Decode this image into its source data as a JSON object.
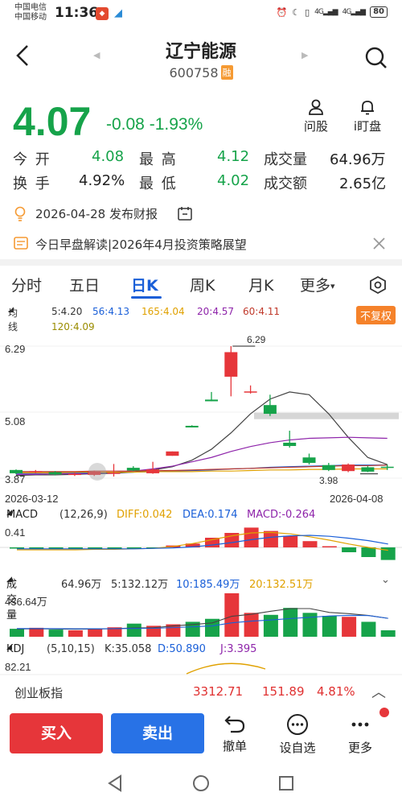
{
  "status_bar": {
    "carrier1": "中国电信",
    "carrier2": "中国移动",
    "time": "11:36",
    "signal1": "4G",
    "signal2": "4G",
    "battery": "80"
  },
  "header": {
    "stock_name": "辽宁能源",
    "stock_code": "600758",
    "badge": "融"
  },
  "quote": {
    "price": "4.07",
    "change": "-0.08",
    "change_pct": "-1.93%",
    "ask_label": "问股",
    "watch_label": "i盯盘",
    "open_label": "今 开",
    "open": "4.08",
    "high_label": "最 高",
    "high": "4.12",
    "volume_label": "成交量",
    "volume": "64.96万",
    "turnover_label": "换 手",
    "turnover": "4.92%",
    "low_label": "最 低",
    "low": "4.02",
    "amount_label": "成交额",
    "amount": "2.65亿"
  },
  "report": {
    "text": "2026-04-28 发布财报"
  },
  "news": {
    "text": "今日早盘解读|2026年4月投资策略展望"
  },
  "tabs": [
    "分时",
    "五日",
    "日K",
    "周K",
    "月K",
    "更多"
  ],
  "ma": {
    "title": "均线",
    "ma5": "5:4.20",
    "ma56": "56:4.13",
    "ma165": "165:4.04",
    "ma20": "20:4.57",
    "ma60": "60:4.11",
    "ma120": "120:4.09",
    "fuquan": "不复权"
  },
  "kline": {
    "y_top": "6.29",
    "y_mid": "5.08",
    "y_bottom": "3.87",
    "high_mark": "6.29",
    "low_mark": "3.98",
    "date_start": "2026-03-12",
    "date_end": "2026-04-08"
  },
  "macd": {
    "title": "MACD",
    "params": "(12,26,9)",
    "diff": "DIFF:0.042",
    "dea": "DEA:0.174",
    "macd": "MACD:-0.264",
    "top": "0.41"
  },
  "volume": {
    "title": "成交量",
    "value": "64.96万",
    "v5": "5:132.12万",
    "v10": "10:185.49万",
    "v20": "20:132.51万",
    "top": "436.64万"
  },
  "kdj": {
    "title": "KDJ",
    "params": "(5,10,15)",
    "k": "K:35.058",
    "d": "D:50.890",
    "j": "J:3.395",
    "top": "82.21"
  },
  "index_bar": {
    "name": "创业板指",
    "value": "3312.71",
    "change": "151.89",
    "pct": "4.81%"
  },
  "actions": {
    "buy": "买入",
    "sell": "卖出",
    "cancel": "撤单",
    "watchlist": "设自选",
    "more": "更多"
  },
  "colors": {
    "up": "#e6363a",
    "down": "#16a34a",
    "accent": "#1a5fd8"
  },
  "chart_data": [
    {
      "type": "candlestick",
      "title": "",
      "ylim": [
        3.87,
        6.29
      ],
      "x": [
        "2026-03-12",
        "...",
        "2026-04-08"
      ],
      "candles": [
        {
          "o": 4.02,
          "c": 3.96,
          "h": 4.03,
          "l": 3.94
        },
        {
          "o": 3.98,
          "c": 4.0,
          "h": 4.02,
          "l": 3.96
        },
        {
          "o": 3.98,
          "c": 3.94,
          "h": 4.0,
          "l": 3.92
        },
        {
          "o": 3.94,
          "c": 3.95,
          "h": 3.97,
          "l": 3.91
        },
        {
          "o": 3.93,
          "c": 3.99,
          "h": 4.01,
          "l": 3.91
        },
        {
          "o": 3.96,
          "c": 3.97,
          "h": 4.13,
          "l": 3.9
        },
        {
          "o": 4.06,
          "c": 4.01,
          "h": 4.09,
          "l": 4.0
        },
        {
          "o": 3.96,
          "c": 4.03,
          "h": 4.17,
          "l": 3.95
        },
        {
          "o": 4.28,
          "c": 4.36,
          "h": 4.36,
          "l": 4.28
        },
        {
          "o": 4.83,
          "c": 4.8,
          "h": 4.84,
          "l": 4.8
        },
        {
          "o": 5.31,
          "c": 5.28,
          "h": 5.45,
          "l": 5.28
        },
        {
          "o": 5.73,
          "c": 6.18,
          "h": 6.29,
          "l": 5.37
        },
        {
          "o": 5.44,
          "c": 5.46,
          "h": 5.57,
          "l": 5.42
        },
        {
          "o": 5.21,
          "c": 5.05,
          "h": 5.4,
          "l": 5.01
        },
        {
          "o": 4.52,
          "c": 4.46,
          "h": 4.74,
          "l": 4.43
        },
        {
          "o": 4.25,
          "c": 4.15,
          "h": 4.32,
          "l": 4.12
        },
        {
          "o": 4.11,
          "c": 4.02,
          "h": 4.15,
          "l": 4.0
        },
        {
          "o": 4.0,
          "c": 4.12,
          "h": 4.14,
          "l": 3.98
        },
        {
          "o": 4.07,
          "c": 3.99,
          "h": 4.09,
          "l": 3.98
        },
        {
          "o": 4.08,
          "c": 4.07,
          "h": 4.12,
          "l": 4.02
        }
      ]
    },
    {
      "type": "bar",
      "title": "MACD",
      "values": [
        -0.01,
        -0.01,
        -0.01,
        -0.01,
        -0.01,
        -0.01,
        -0.01,
        -0.02,
        0.04,
        0.08,
        0.2,
        0.3,
        0.41,
        0.34,
        0.24,
        0.13,
        0.0,
        -0.1,
        -0.2,
        -0.26
      ]
    },
    {
      "type": "bar",
      "title": "成交量",
      "ylim": [
        0,
        436.64
      ],
      "values": [
        80,
        90,
        72,
        65,
        82,
        95,
        132,
        110,
        125,
        150,
        180,
        436.64,
        240,
        220,
        290,
        240,
        210,
        200,
        150,
        64.96
      ]
    }
  ]
}
